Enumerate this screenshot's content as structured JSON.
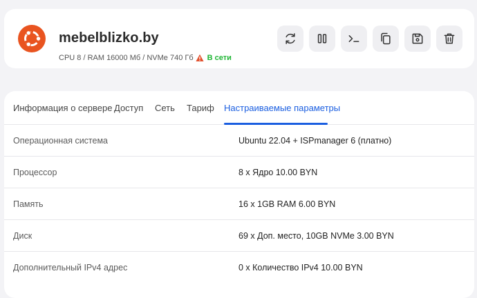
{
  "server": {
    "name": "mebelblizko.by",
    "specs": "CPU 8 / RAM 16000 Мб / NVMe 740 Гб",
    "status": "В сети",
    "logo_icon": "ubuntu-logo-icon",
    "warning_icon": "warning-triangle-icon"
  },
  "actions": [
    {
      "icon": "refresh-icon"
    },
    {
      "icon": "pause-icon"
    },
    {
      "icon": "terminal-icon"
    },
    {
      "icon": "copy-icon"
    },
    {
      "icon": "save-icon"
    },
    {
      "icon": "trash-icon"
    }
  ],
  "tabs": [
    {
      "label": "Информация о сервере"
    },
    {
      "label": "Доступ"
    },
    {
      "label": "Сеть"
    },
    {
      "label": "Тариф"
    },
    {
      "label": "Настраиваемые параметры"
    }
  ],
  "active_tab": "Настраиваемые параметры",
  "rows": [
    {
      "label": "Операционная система",
      "value": "Ubuntu 22.04 + ISPmanager 6 (платно)"
    },
    {
      "label": "Процессор",
      "value": "8 x Ядро 10.00 BYN"
    },
    {
      "label": "Память",
      "value": "16 x 1GB RAM 6.00 BYN"
    },
    {
      "label": "Диск",
      "value": "69 x Доп. место, 10GB NVMe 3.00 BYN"
    },
    {
      "label": "Дополнительный IPv4 адрес",
      "value": "0 x Количество IPv4 10.00 BYN"
    }
  ],
  "colors": {
    "accent": "#1a5ee0",
    "online": "#1fb534",
    "ubuntu": "#e95420",
    "warning": "#e2502d"
  }
}
